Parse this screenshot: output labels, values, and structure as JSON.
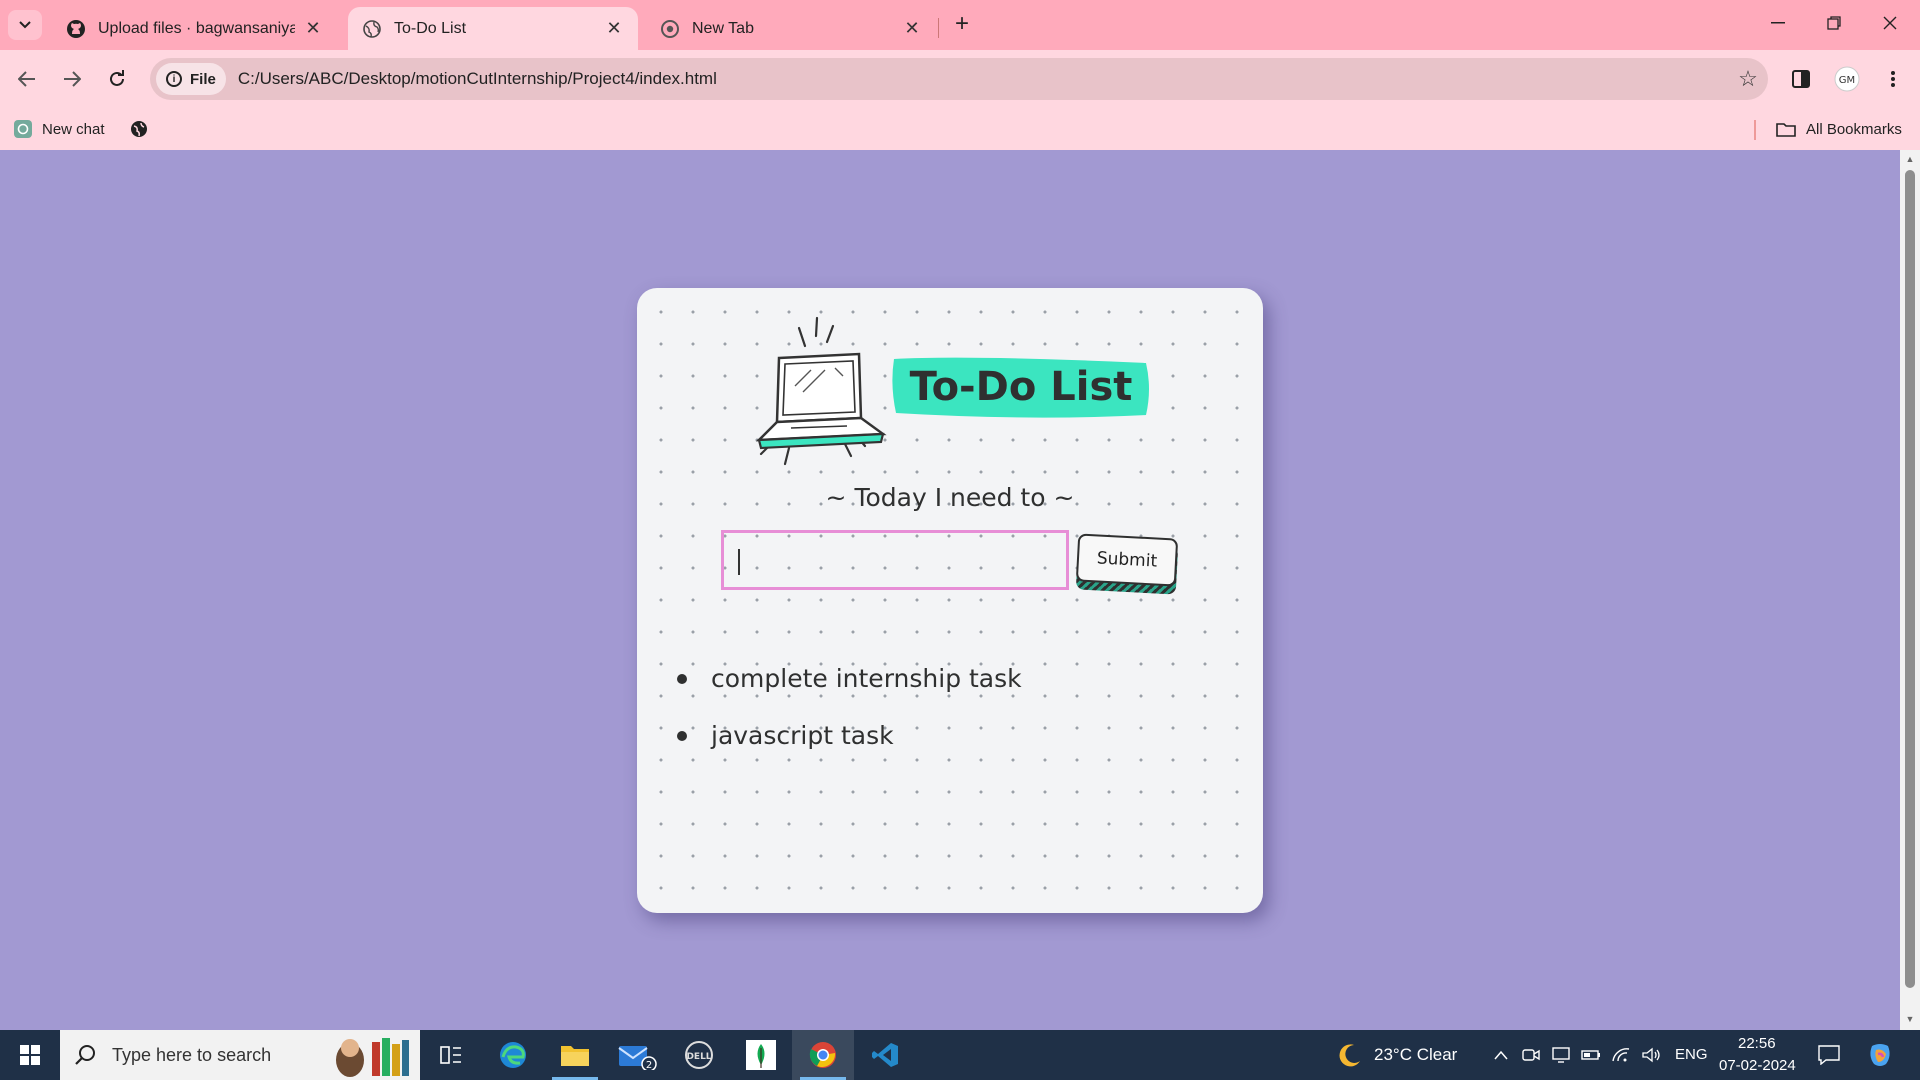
{
  "browser": {
    "tabs": [
      {
        "title": "Upload files · bagwansaniya/Pro",
        "active": false
      },
      {
        "title": "To-Do List",
        "active": true
      },
      {
        "title": "New Tab",
        "active": false
      }
    ],
    "omnibox": {
      "chip_label": "File",
      "url": "C:/Users/ABC/Desktop/motionCutInternship/Project4/index.html"
    },
    "bookmarks": [
      {
        "label": "New chat"
      }
    ],
    "all_bookmarks_label": "All Bookmarks"
  },
  "page": {
    "title": "To-Do List",
    "subtitle": "~ Today I need to ~",
    "input_value": "",
    "submit_label": "Submit",
    "tasks": [
      "complete internship task",
      "javascript task"
    ],
    "colors": {
      "background": "#a299d2",
      "highlight": "#3be5c0",
      "input_border": "#e78ed6",
      "text": "#2f3030"
    }
  },
  "taskbar": {
    "search_placeholder": "Type here to search",
    "mail_badge": "2",
    "weather": "23°C  Clear",
    "language": "ENG",
    "time": "22:56",
    "date": "07-02-2024"
  }
}
